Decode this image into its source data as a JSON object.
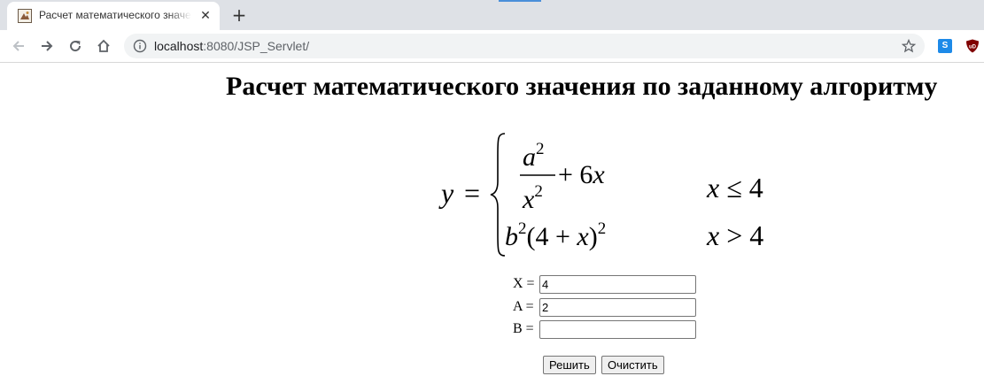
{
  "browser": {
    "tab_title": "Расчет математического значения по заданному алгоритму",
    "tab_close": "✕",
    "new_tab": "+",
    "url_host": "localhost",
    "url_rest": ":8080/JSP_Servlet/",
    "extensions": [
      {
        "name": "s-extension-icon",
        "label": "S",
        "color": "#1d8ae8"
      },
      {
        "name": "ublock-icon",
        "label": "uD",
        "color": "#800000"
      }
    ]
  },
  "page": {
    "heading": "Расчет математического значения по заданному алгоритму",
    "formula": {
      "lhs": "y =",
      "case1_expr": "a²/x² + 6x",
      "case1_cond": "x ≤ 4",
      "case2_expr": "b²(4 + x)²",
      "case2_cond": "x > 4"
    },
    "fields": [
      {
        "label": "X =",
        "value": "4"
      },
      {
        "label": "A =",
        "value": "2"
      },
      {
        "label": "B =",
        "value": ""
      }
    ],
    "buttons": {
      "solve": "Решить",
      "clear": "Очистить"
    }
  }
}
